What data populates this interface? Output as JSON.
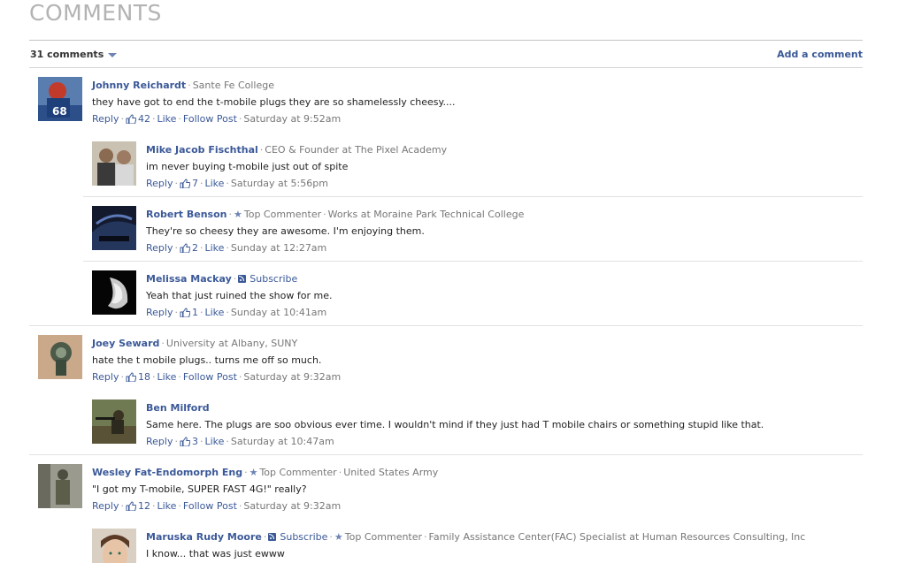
{
  "section": {
    "heading": "COMMENTS"
  },
  "bar": {
    "count_label": "31 comments",
    "add_label": "Add a comment"
  },
  "actions": {
    "reply": "Reply",
    "like": "Like",
    "follow": "Follow Post",
    "subscribe": "Subscribe",
    "top_commenter": "Top Commenter"
  },
  "comments": [
    {
      "author": "Johnny Reichardt",
      "affiliation": "Sante Fe College",
      "text": "they have got to end the t-mobile plugs they are so shamelessly cheesy....",
      "likes": "42",
      "time": "Saturday at 9:52am"
    },
    {
      "author": "Mike Jacob Fischthal",
      "affiliation": "CEO & Founder at The Pixel Academy",
      "text": "im never buying t-mobile just out of spite",
      "likes": "7",
      "time": "Saturday at 5:56pm"
    },
    {
      "author": "Robert Benson",
      "affiliation": "Works at Moraine Park Technical College",
      "text": "They're so cheesy they are awesome. I'm enjoying them.",
      "likes": "2",
      "time": "Sunday at 12:27am"
    },
    {
      "author": "Melissa Mackay",
      "text": "Yeah that just ruined the show for me.",
      "likes": "1",
      "time": "Sunday at 10:41am"
    },
    {
      "author": "Joey Seward",
      "affiliation": "University at Albany, SUNY",
      "text": "hate the t mobile plugs.. turns me off so much.",
      "likes": "18",
      "time": "Saturday at 9:32am"
    },
    {
      "author": "Ben Milford",
      "text": "Same here. The plugs are soo obvious ever time. I wouldn't mind if they just had T mobile chairs or something stupid like that.",
      "likes": "3",
      "time": "Saturday at 10:47am"
    },
    {
      "author": "Wesley Fat-Endomorph Eng",
      "affiliation": "United States Army",
      "text": "\"I got my T-mobile, SUPER FAST 4G!\" really?",
      "likes": "12",
      "time": "Saturday at 9:32am"
    },
    {
      "author": "Maruska Rudy Moore",
      "affiliation": "Family Assistance Center(FAC) Specialist at Human Resources Consulting, Inc",
      "text": "I know... that was just ewww"
    }
  ]
}
